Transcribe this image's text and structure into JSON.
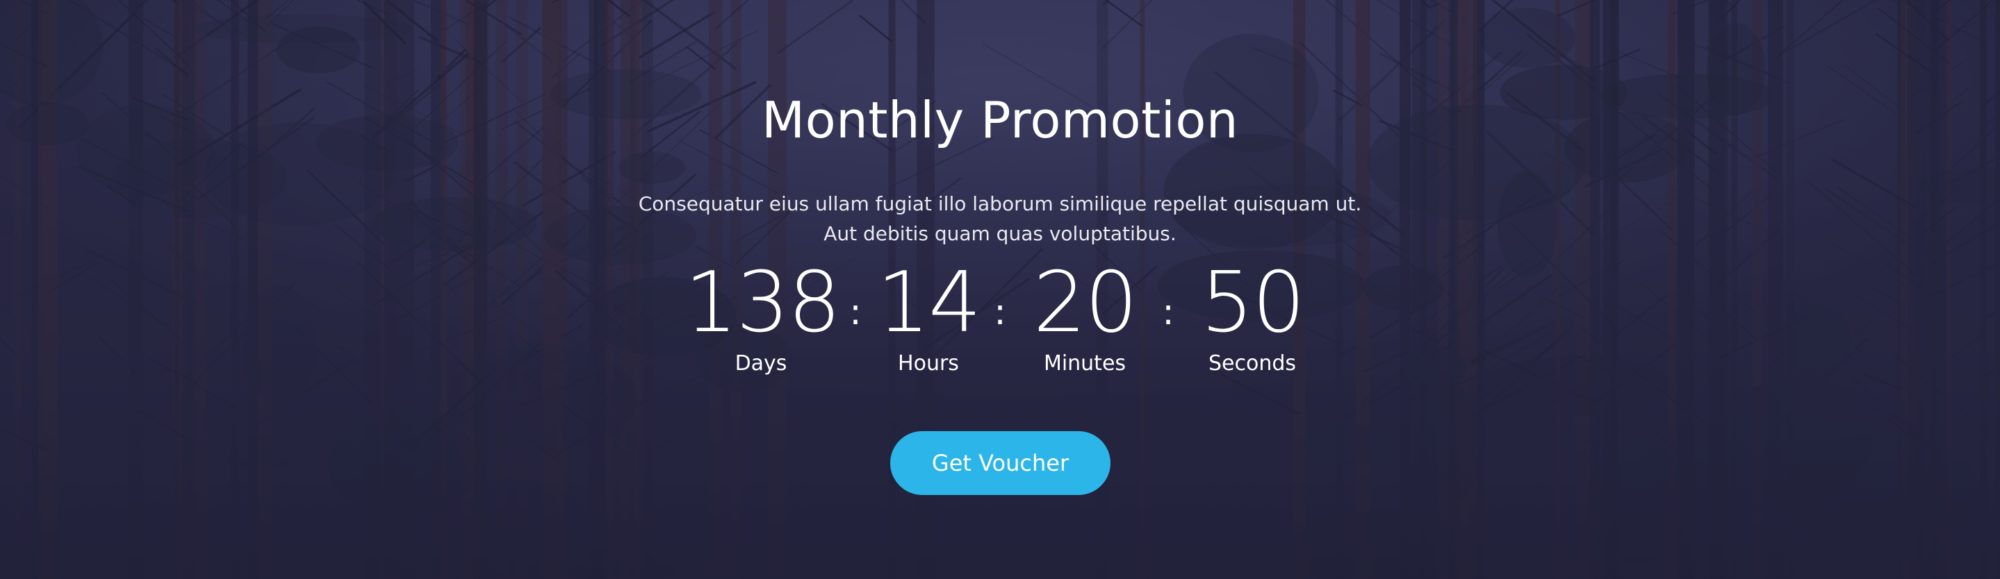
{
  "promo": {
    "title": "Monthly Promotion",
    "description_line1": "Consequatur eius ullam fugiat illo laborum similique repellat quisquam ut.",
    "description_line2": "Aut debitis quam quas voluptatibus.",
    "separator": ":",
    "countdown": {
      "days": "138",
      "days_label": "Days",
      "hours": "14",
      "hours_label": "Hours",
      "minutes": "20",
      "minutes_label": "Minutes",
      "seconds": "50",
      "seconds_label": "Seconds"
    },
    "cta_label": "Get Voucher"
  },
  "theme": {
    "accent": "#2cb5e8",
    "overlay": "#2a2a4a",
    "text": "#ffffff"
  },
  "background": {
    "image_icon": "forest-photo"
  }
}
